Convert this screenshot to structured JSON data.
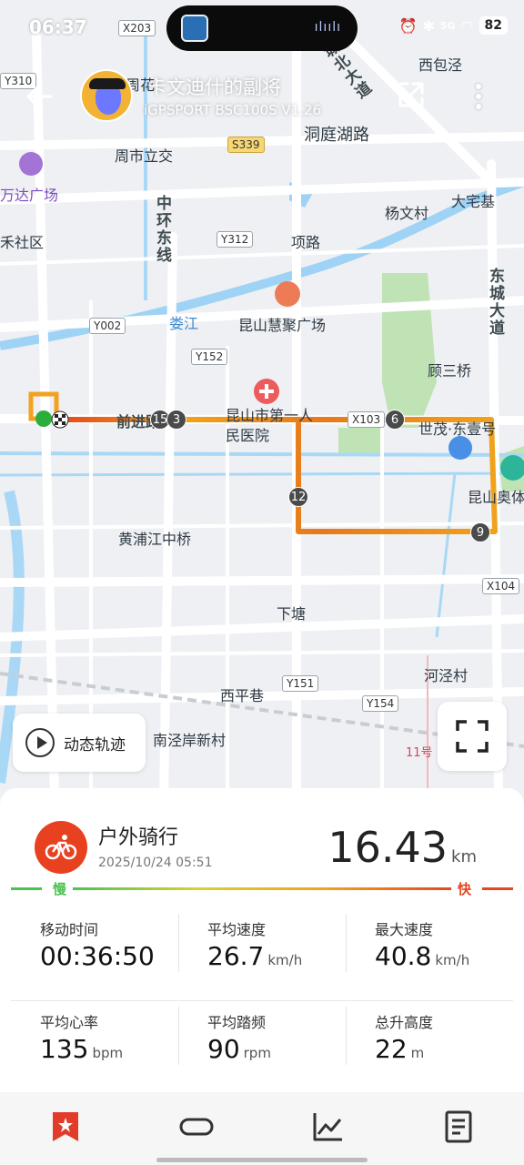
{
  "status_bar": {
    "time": "06:37",
    "battery": "82",
    "signal_label": "5G"
  },
  "header": {
    "title": "卡文迪什的副将",
    "subtitle": "iGPSPORT BSC100S  V1.26"
  },
  "map": {
    "labels": {
      "x203": "X203",
      "y310": "Y310",
      "s339": "S339",
      "y312": "Y312",
      "y002": "Y002",
      "y152": "Y152",
      "x103": "X103",
      "x104": "X104",
      "y151": "Y151",
      "y154": "Y154",
      "xibaojing": "西包泾",
      "dongtinghu_road": "洞庭湖路",
      "zhoushi_interchange": "周市立交",
      "wanda_plaza": "万达广场",
      "he_community": "禾社区",
      "yangwencun": "杨文村",
      "dazhaiji": "大宅基",
      "xianglu": "项路",
      "loujiang": "娄江",
      "huiju_plaza": "昆山慧聚广场",
      "gusanqiao": "顾三桥",
      "first_hospital": "昆山市第一人民医院",
      "shimao": "世茂·东壹号",
      "kunshan_olympic": "昆山奥体",
      "huangpujiang_bridge": "黄浦江中桥",
      "xiatang": "下塘",
      "hejingcun": "河泾村",
      "xipingxiang": "西平巷",
      "nanjingan": "南泾岸新村",
      "line11": "11号",
      "zhonghuan_east": "中环东线",
      "dongcheng_avenue": "东城大道",
      "chengbei_avenue": "城北大道",
      "qianjin_road": "前进路",
      "zhouhua": "周花"
    },
    "markers": [
      "15",
      "3",
      "6",
      "12",
      "9"
    ],
    "colors": {
      "route_slow": "#4cc34f",
      "route_mid": "#f0a21d",
      "route_fast": "#e4481f",
      "start": "#2dae3a",
      "loop": "#f2a21e"
    }
  },
  "controls": {
    "anim_track_label": "动态轨迹"
  },
  "activity": {
    "type": "户外骑行",
    "datetime": "2025/10/24 05:51",
    "distance": "16.43",
    "distance_unit": "km",
    "speed_slow": "慢",
    "speed_fast": "快",
    "accent": "#e8411f"
  },
  "stats": [
    {
      "label": "移动时间",
      "value": "00:36:50",
      "unit": ""
    },
    {
      "label": "平均速度",
      "value": "26.7",
      "unit": "km/h"
    },
    {
      "label": "最大速度",
      "value": "40.8",
      "unit": "km/h"
    },
    {
      "label": "平均心率",
      "value": "135",
      "unit": "bpm"
    },
    {
      "label": "平均踏频",
      "value": "90",
      "unit": "rpm"
    },
    {
      "label": "总升高度",
      "value": "22",
      "unit": "m"
    }
  ],
  "bottom_nav": {
    "items": [
      "bookmark-icon",
      "capsule-icon",
      "chart-icon",
      "report-icon"
    ],
    "active_color": "#e23b2a"
  }
}
